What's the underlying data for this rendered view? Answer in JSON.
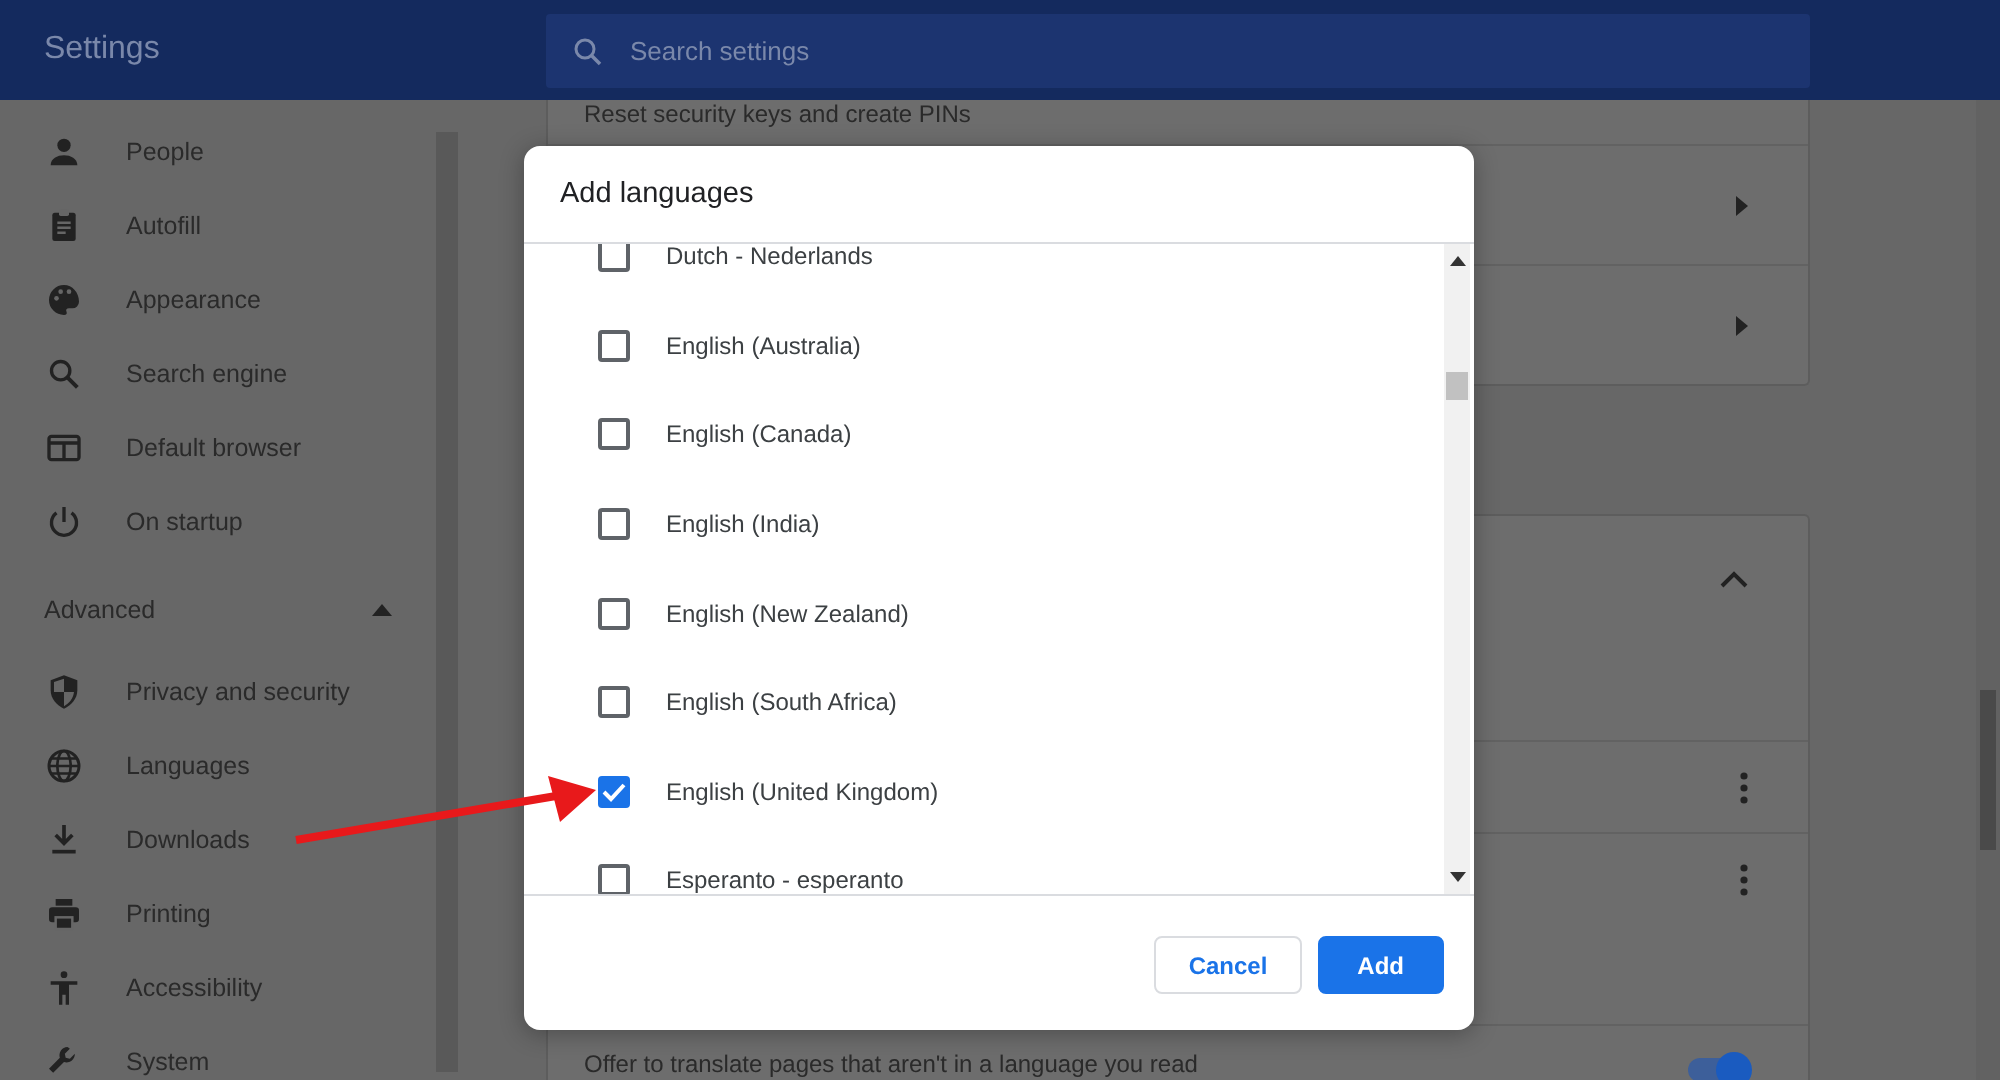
{
  "header": {
    "title": "Settings",
    "search": {
      "placeholder": "Search settings"
    }
  },
  "sidebar": {
    "items": [
      {
        "kind": "item",
        "label": "People"
      },
      {
        "kind": "item",
        "label": "Autofill"
      },
      {
        "kind": "item",
        "label": "Appearance"
      },
      {
        "kind": "item",
        "label": "Search engine"
      },
      {
        "kind": "item",
        "label": "Default browser"
      },
      {
        "kind": "item",
        "label": "On startup"
      },
      {
        "kind": "section",
        "label": "Advanced",
        "expanded": true
      },
      {
        "kind": "item",
        "label": "Privacy and security"
      },
      {
        "kind": "item",
        "label": "Languages"
      },
      {
        "kind": "item",
        "label": "Downloads"
      },
      {
        "kind": "item",
        "label": "Printing"
      },
      {
        "kind": "item",
        "label": "Accessibility"
      },
      {
        "kind": "item",
        "label": "System"
      }
    ]
  },
  "cards": [
    {
      "rows": [
        {
          "kind": "text",
          "text": "Reset security keys and create PINs"
        },
        {
          "kind": "arrow"
        },
        {
          "kind": "arrow"
        }
      ]
    },
    {
      "rows": [
        {
          "kind": "header",
          "expanded": true
        },
        {
          "kind": "blank"
        },
        {
          "kind": "menu"
        },
        {
          "kind": "menu"
        },
        {
          "kind": "blank"
        },
        {
          "kind": "toggle",
          "text": "Offer to translate pages that aren't in a language you read",
          "on": true
        }
      ]
    }
  ],
  "dialog": {
    "title": "Add languages",
    "languages": [
      {
        "label": "Dutch - Nederlands",
        "checked": false
      },
      {
        "label": "English (Australia)",
        "checked": false
      },
      {
        "label": "English (Canada)",
        "checked": false
      },
      {
        "label": "English (India)",
        "checked": false
      },
      {
        "label": "English (New Zealand)",
        "checked": false
      },
      {
        "label": "English (South Africa)",
        "checked": false
      },
      {
        "label": "English (United Kingdom)",
        "checked": true
      },
      {
        "label": "Esperanto - esperanto",
        "checked": false
      }
    ],
    "buttons": [
      {
        "label": "Cancel",
        "kind": "secondary"
      },
      {
        "label": "Add",
        "kind": "primary"
      }
    ]
  }
}
